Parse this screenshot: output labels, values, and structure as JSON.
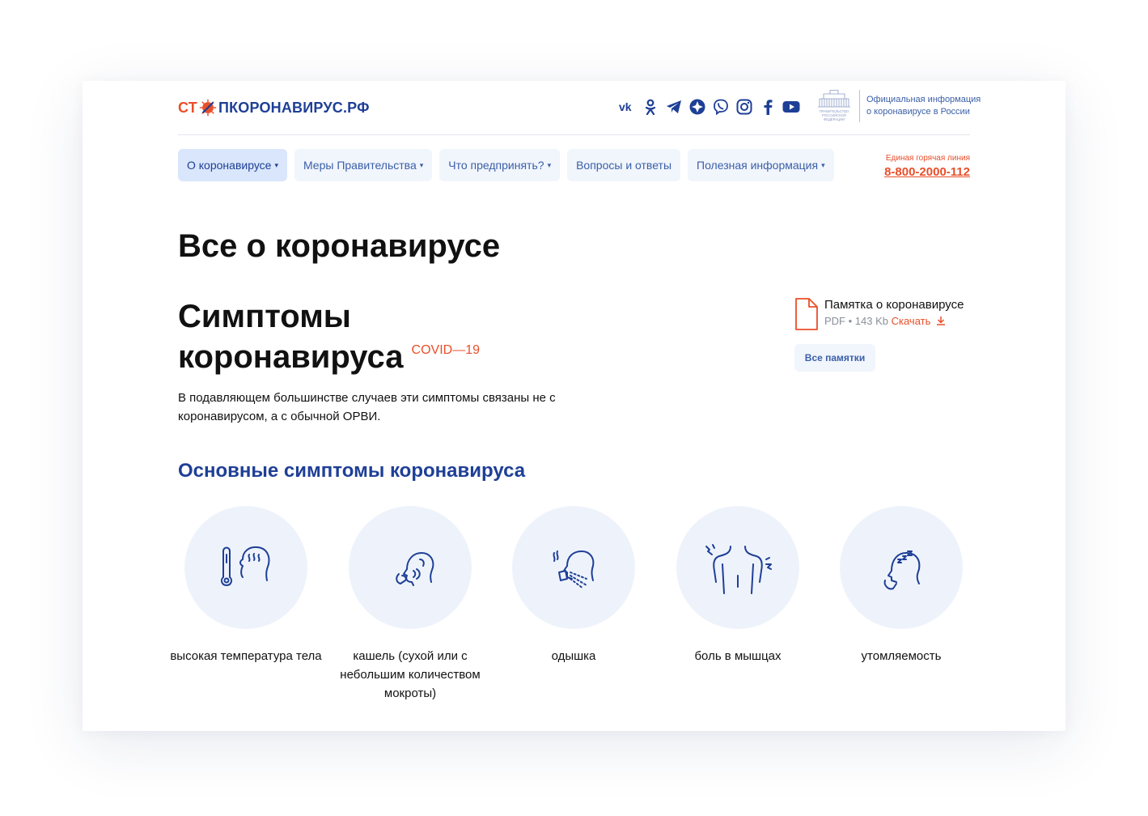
{
  "header": {
    "logo": {
      "part1": "СТ",
      "part2": "ПКОРОНАВИРУС.РФ"
    },
    "social": [
      "vk-icon",
      "ok-icon",
      "telegram-icon",
      "yandex-zen-icon",
      "viber-icon",
      "instagram-icon",
      "facebook-icon",
      "youtube-icon"
    ],
    "gov_emblem_text": "ПРАВИТЕЛЬСТВО РОССИЙСКОЙ ФЕДЕРАЦИИ",
    "gov_info_line1": "Официальная информация",
    "gov_info_line2": "о коронавирусе в России"
  },
  "nav": {
    "items": [
      {
        "label": "О коронавирусе",
        "caret": "▾"
      },
      {
        "label": "Меры Правительства",
        "caret": "▾"
      },
      {
        "label": "Что предпринять?",
        "caret": "▾"
      },
      {
        "label": "Вопросы и ответы",
        "caret": ""
      },
      {
        "label": "Полезная информация",
        "caret": "▾"
      }
    ],
    "hotline_label": "Единая горячая линия",
    "hotline_number": "8-800-2000-112"
  },
  "main": {
    "title": "Все о коронавирусе",
    "subtitle_line1": "Симптомы",
    "subtitle_line2": "коронавируса",
    "subtitle_tag": "COVID—19",
    "lead": "В подавляющем большинстве случаев эти симптомы связаны не с коронавирусом, а с обычной ОРВИ."
  },
  "memo": {
    "title": "Памятка о коронавирусе",
    "meta": "PDF • 143 Kb",
    "download": "Скачать",
    "all_button": "Все памятки"
  },
  "symptoms": {
    "heading": "Основные симптомы коронавируса",
    "items": [
      {
        "label": "высокая температура тела",
        "icon": "thermometer-head-icon"
      },
      {
        "label": "кашель (сухой или с небольшим количеством мокроты)",
        "icon": "cough-icon"
      },
      {
        "label": "одышка",
        "icon": "shortness-of-breath-icon"
      },
      {
        "label": "боль в мышцах",
        "icon": "muscle-pain-icon"
      },
      {
        "label": "утомляемость",
        "icon": "fatigue-icon"
      }
    ]
  },
  "colors": {
    "brand_red": "#e94f2a",
    "brand_blue": "#1e3f96",
    "nav_bg": "#f1f5fc",
    "circle_bg": "#eef3fb"
  }
}
